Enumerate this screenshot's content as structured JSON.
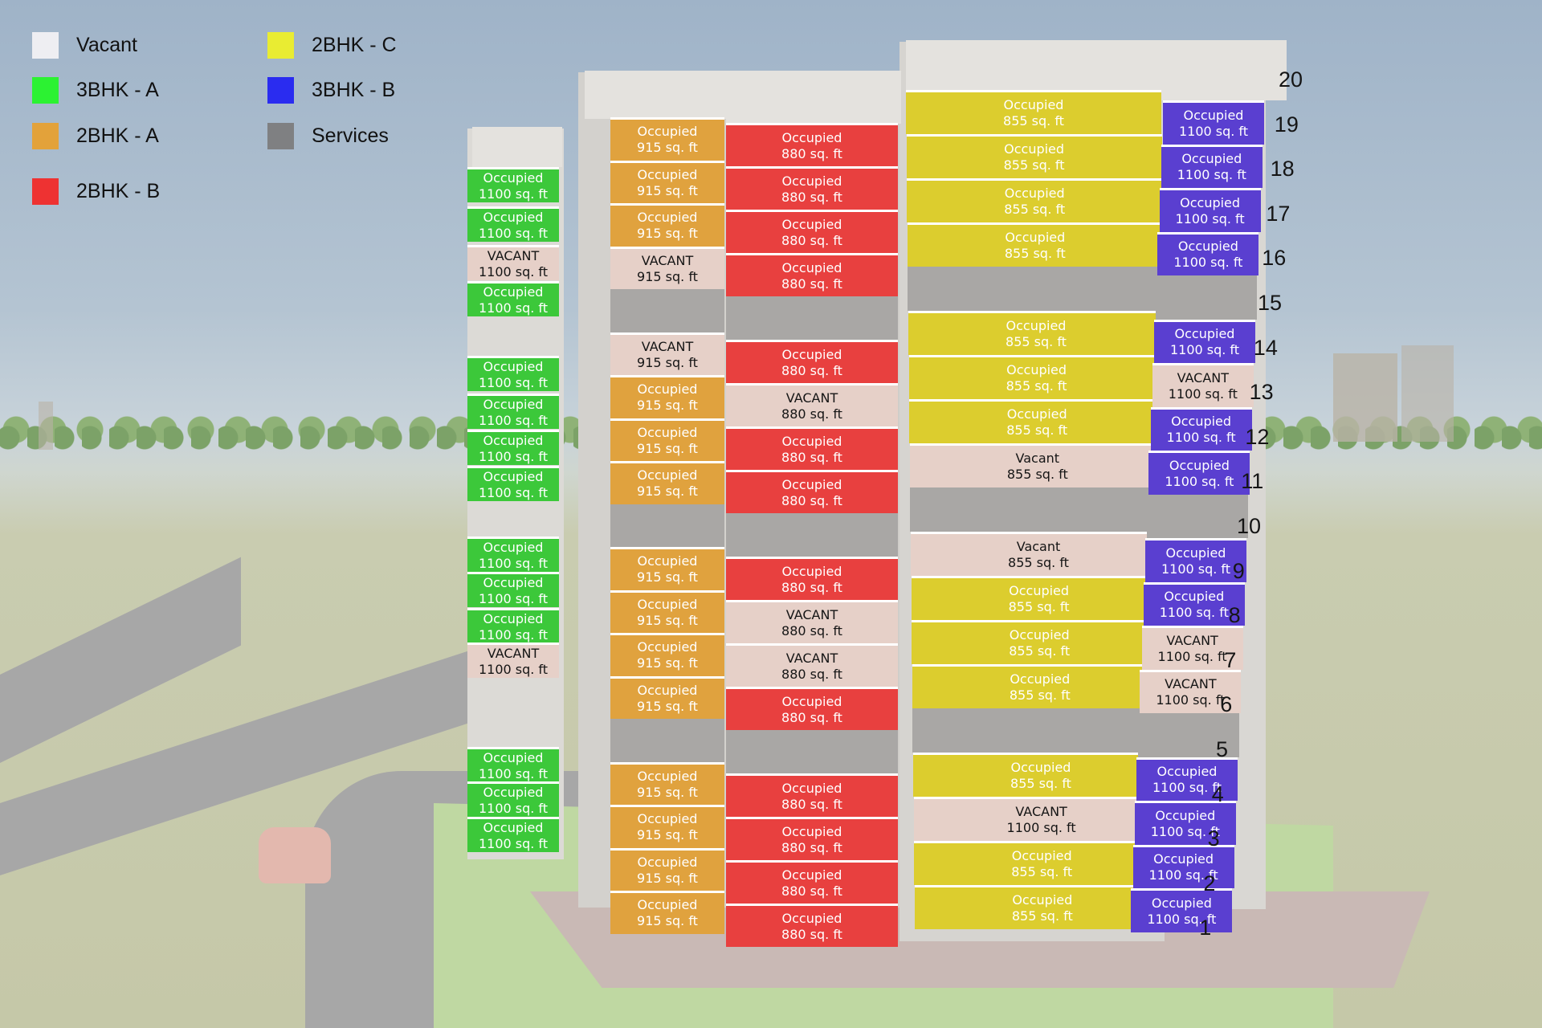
{
  "legend": [
    {
      "key": "vacant",
      "label": "Vacant",
      "color": "#eeeef2"
    },
    {
      "key": "3bhk_a",
      "label": "3BHK - A",
      "color": "#2cf232"
    },
    {
      "key": "2bhk_a",
      "label": "2BHK - A",
      "color": "#e3a23a"
    },
    {
      "key": "2bhk_b",
      "label": "2BHK - B",
      "color": "#ee3232"
    },
    {
      "key": "2bhk_c",
      "label": "2BHK - C",
      "color": "#e9ec32"
    },
    {
      "key": "3bhk_b",
      "label": "3BHK - B",
      "color": "#2a2cf0"
    },
    {
      "key": "services",
      "label": "Services",
      "color": "#7f8082"
    }
  ],
  "unit_fill": {
    "3bhk_a": "#3cc83a",
    "2bhk_a": "#e0a23e",
    "2bhk_b": "#e8403f",
    "2bhk_c": "#dccd2e",
    "3bhk_b": "#5a3fd0",
    "vacant": "#e6d0c8",
    "services": "#a9a7a5"
  },
  "floor_numbers": [
    "20",
    "19",
    "18",
    "17",
    "16",
    "15",
    "14",
    "13",
    "12",
    "11",
    "10",
    "9",
    "8",
    "7",
    "6",
    "5",
    "4",
    "3",
    "2",
    "1"
  ],
  "status_labels": {
    "occupied": "Occupied",
    "vacant_upper": "VACANT",
    "vacant_title": "Vacant"
  },
  "columns": [
    {
      "type": "3bhk_a",
      "area": "1100 sq. ft",
      "units": [
        {
          "floor": "19",
          "status": "Occupied"
        },
        {
          "floor": "18",
          "status": "Occupied"
        },
        {
          "floor": "17",
          "status": "VACANT"
        },
        {
          "floor": "16",
          "status": "Occupied"
        },
        {
          "floor": "14",
          "status": "Occupied"
        },
        {
          "floor": "13",
          "status": "Occupied"
        },
        {
          "floor": "12",
          "status": "Occupied"
        },
        {
          "floor": "11",
          "status": "Occupied"
        },
        {
          "floor": "10",
          "status": "Occupied"
        },
        {
          "floor": "9",
          "status": "Occupied"
        },
        {
          "floor": "8",
          "status": "Occupied"
        },
        {
          "floor": "7",
          "status": "VACANT"
        },
        {
          "floor": "4",
          "status": "Occupied"
        },
        {
          "floor": "3",
          "status": "Occupied"
        },
        {
          "floor": "2",
          "status": "Occupied"
        }
      ]
    },
    {
      "type": "2bhk_a",
      "area": "915 sq. ft",
      "units": [
        {
          "floor": "19",
          "status": "Occupied"
        },
        {
          "floor": "18",
          "status": "Occupied"
        },
        {
          "floor": "17",
          "status": "Occupied"
        },
        {
          "floor": "16",
          "status": "VACANT"
        },
        {
          "floor": "15",
          "status": "services"
        },
        {
          "floor": "14",
          "status": "VACANT"
        },
        {
          "floor": "13",
          "status": "Occupied"
        },
        {
          "floor": "12",
          "status": "Occupied"
        },
        {
          "floor": "11",
          "status": "Occupied"
        },
        {
          "floor": "10",
          "status": "services"
        },
        {
          "floor": "9",
          "status": "Occupied"
        },
        {
          "floor": "8",
          "status": "Occupied"
        },
        {
          "floor": "7",
          "status": "Occupied"
        },
        {
          "floor": "6",
          "status": "Occupied"
        },
        {
          "floor": "5",
          "status": "services"
        },
        {
          "floor": "4",
          "status": "Occupied"
        },
        {
          "floor": "3",
          "status": "Occupied"
        },
        {
          "floor": "2",
          "status": "Occupied"
        },
        {
          "floor": "1",
          "status": "Occupied"
        }
      ]
    },
    {
      "type": "2bhk_b",
      "area": "880 sq. ft",
      "units": [
        {
          "floor": "19",
          "status": "Occupied"
        },
        {
          "floor": "18",
          "status": "Occupied"
        },
        {
          "floor": "17",
          "status": "Occupied"
        },
        {
          "floor": "16",
          "status": "Occupied"
        },
        {
          "floor": "15",
          "status": "services"
        },
        {
          "floor": "14",
          "status": "Occupied"
        },
        {
          "floor": "13",
          "status": "VACANT"
        },
        {
          "floor": "12",
          "status": "Occupied"
        },
        {
          "floor": "11",
          "status": "Occupied"
        },
        {
          "floor": "10",
          "status": "services"
        },
        {
          "floor": "9",
          "status": "Occupied"
        },
        {
          "floor": "8",
          "status": "VACANT"
        },
        {
          "floor": "7",
          "status": "VACANT"
        },
        {
          "floor": "6",
          "status": "Occupied"
        },
        {
          "floor": "5",
          "status": "services"
        },
        {
          "floor": "4",
          "status": "Occupied"
        },
        {
          "floor": "3",
          "status": "Occupied"
        },
        {
          "floor": "2",
          "status": "Occupied"
        },
        {
          "floor": "1",
          "status": "Occupied"
        }
      ]
    },
    {
      "type": "2bhk_c",
      "area": "855 sq. ft",
      "units": [
        {
          "floor": "19",
          "status": "Occupied"
        },
        {
          "floor": "18",
          "status": "Occupied"
        },
        {
          "floor": "17",
          "status": "Occupied"
        },
        {
          "floor": "16",
          "status": "Occupied"
        },
        {
          "floor": "15",
          "status": "services"
        },
        {
          "floor": "14",
          "status": "Occupied"
        },
        {
          "floor": "13",
          "status": "Occupied"
        },
        {
          "floor": "12",
          "status": "Occupied"
        },
        {
          "floor": "11",
          "status": "Vacant"
        },
        {
          "floor": "10",
          "status": "services"
        },
        {
          "floor": "9",
          "status": "Vacant"
        },
        {
          "floor": "8",
          "status": "Occupied"
        },
        {
          "floor": "7",
          "status": "Occupied"
        },
        {
          "floor": "6",
          "status": "Occupied"
        },
        {
          "floor": "5",
          "status": "services"
        },
        {
          "floor": "4",
          "status": "Occupied"
        },
        {
          "floor": "3",
          "status": "VACANT",
          "area": "1100 sq. ft"
        },
        {
          "floor": "2",
          "status": "Occupied"
        },
        {
          "floor": "1",
          "status": "Occupied"
        }
      ]
    },
    {
      "type": "3bhk_b",
      "area": "1100 sq. ft",
      "units": [
        {
          "floor": "19",
          "status": "Occupied"
        },
        {
          "floor": "18",
          "status": "Occupied"
        },
        {
          "floor": "17",
          "status": "Occupied"
        },
        {
          "floor": "16",
          "status": "Occupied"
        },
        {
          "floor": "15",
          "status": "services"
        },
        {
          "floor": "14",
          "status": "Occupied"
        },
        {
          "floor": "13",
          "status": "VACANT"
        },
        {
          "floor": "12",
          "status": "Occupied"
        },
        {
          "floor": "11",
          "status": "Occupied"
        },
        {
          "floor": "10",
          "status": "services"
        },
        {
          "floor": "9",
          "status": "Occupied"
        },
        {
          "floor": "8",
          "status": "Occupied"
        },
        {
          "floor": "7",
          "status": "VACANT"
        },
        {
          "floor": "6",
          "status": "VACANT"
        },
        {
          "floor": "5",
          "status": "services"
        },
        {
          "floor": "4",
          "status": "Occupied"
        },
        {
          "floor": "3",
          "status": "Occupied"
        },
        {
          "floor": "2",
          "status": "Occupied"
        },
        {
          "floor": "1",
          "status": "Occupied"
        }
      ]
    }
  ]
}
